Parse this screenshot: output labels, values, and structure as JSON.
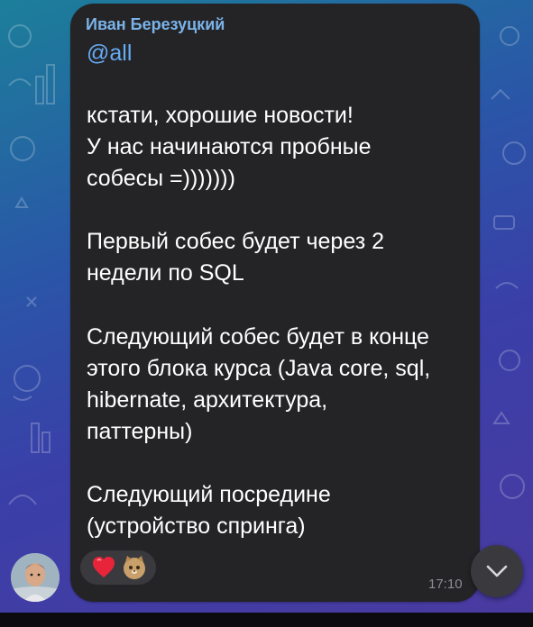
{
  "message": {
    "sender": "Иван Березуцкий",
    "mention": "@all",
    "paragraphs": [
      "кстати, хорошие новости!\nУ нас начинаются пробные\nсобесы =)))))))",
      "Первый собес будет через 2\nнедели по SQL",
      "Следующий собес будет в конце\nэтого блока курса (Java core, sql,\nhibernate, архитектура,\nпаттерны)",
      "Следующий посредине\n(устройство спринга)"
    ],
    "time": "17:10",
    "reactions": [
      "heart-emoji",
      "cat-emoji"
    ]
  },
  "colors": {
    "sender": "#7ab3e8",
    "mention": "#66acf4",
    "bubble": "#242427",
    "text": "#ffffff"
  },
  "icons": {
    "scroll_button": "chevron-down-icon"
  }
}
